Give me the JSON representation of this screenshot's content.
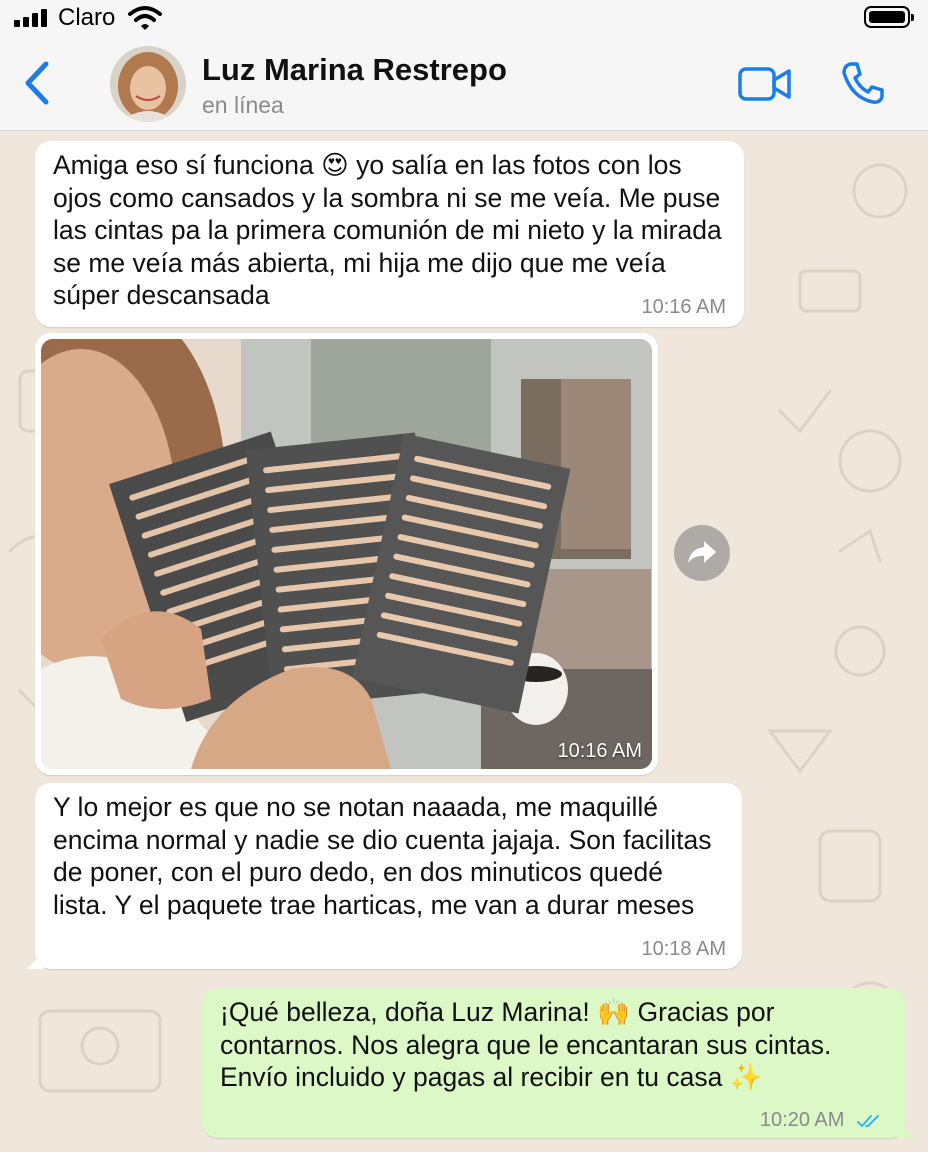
{
  "status_bar": {
    "carrier": "Claro"
  },
  "header": {
    "name": "Luz Marina Restrepo",
    "status": "en línea"
  },
  "colors": {
    "accent": "#1a7ee6",
    "outgoing_bubble": "#dcf8c6",
    "incoming_bubble": "#ffffff",
    "read_ticks": "#34b7f1"
  },
  "messages": [
    {
      "type": "text",
      "direction": "incoming",
      "text": "Amiga eso sí funciona 😍 yo salía en las fotos con los ojos como cansados y la sombra ni se me veía. Me puse las cintas pa la primera comunión de mi nieto y la mirada se me veía más abierta, mi hija me dijo que me veía súper descansada",
      "time": "10:16 AM"
    },
    {
      "type": "image",
      "direction": "incoming",
      "time": "10:16 AM"
    },
    {
      "type": "text",
      "direction": "incoming",
      "text": "Y lo mejor es que no se notan naaada, me maquillé encima normal y nadie se dio cuenta jajaja. Son facilitas de poner, con el puro dedo, en dos minuticos quedé lista. Y el paquete trae harticas, me van a durar meses",
      "time": "10:18 AM"
    },
    {
      "type": "text",
      "direction": "outgoing",
      "text": "¡Qué belleza, doña Luz Marina! 🙌 Gracias por contarnos. Nos alegra que le encantaran sus cintas. Envío incluido y pagas al recibir en tu casa ✨",
      "time": "10:20 AM",
      "status": "read"
    }
  ],
  "icons": [
    "back-chevron-icon",
    "video-call-icon",
    "phone-call-icon",
    "forward-icon",
    "read-receipt-icon",
    "wifi-icon",
    "battery-icon",
    "signal-icon"
  ]
}
